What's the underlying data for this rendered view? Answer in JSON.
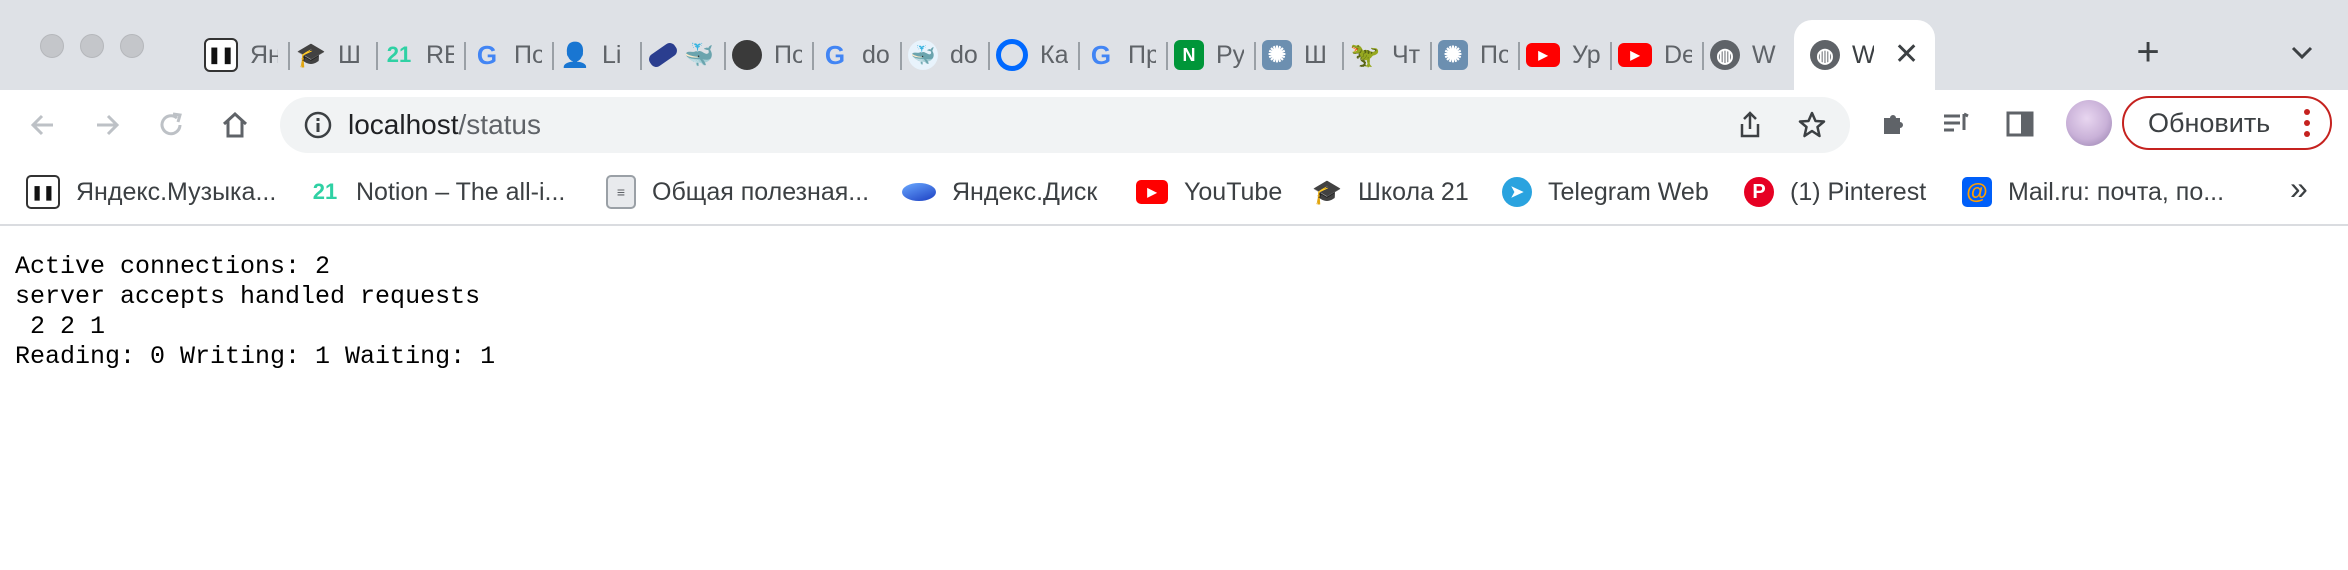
{
  "window": {
    "controls": [
      "close",
      "minimize",
      "zoom"
    ]
  },
  "tabs": [
    {
      "icon": "yandex-music-icon",
      "title": "Ян",
      "color": "#ffffff"
    },
    {
      "icon": "school21-icon",
      "title": "Ш",
      "color": "#ffffff"
    },
    {
      "icon": "notion-21-icon",
      "title": "RE",
      "color": "#ffffff"
    },
    {
      "icon": "google-icon",
      "title": "По",
      "color": "#ffffff"
    },
    {
      "icon": "linkedin-user-icon",
      "title": "Li",
      "color": "#ffffff"
    },
    {
      "icon": "usb-docker-icon",
      "title": "",
      "color": "#ffffff"
    },
    {
      "icon": "person-photo-icon",
      "title": "По",
      "color": "#ffffff"
    },
    {
      "icon": "google-icon",
      "title": "do",
      "color": "#ffffff"
    },
    {
      "icon": "docker-icon",
      "title": "do",
      "color": "#ffffff"
    },
    {
      "icon": "digitalocean-icon",
      "title": "Ка",
      "color": "#ffffff"
    },
    {
      "icon": "google-icon",
      "title": "Пр",
      "color": "#ffffff"
    },
    {
      "icon": "nginx-icon",
      "title": "Py",
      "color": "#ffffff"
    },
    {
      "icon": "splash-icon",
      "title": "Ш",
      "color": "#ffffff"
    },
    {
      "icon": "dino-icon",
      "title": "Чт",
      "color": "#ffffff"
    },
    {
      "icon": "splash-icon",
      "title": "По",
      "color": "#ffffff"
    },
    {
      "icon": "youtube-icon",
      "title": "Ур",
      "color": "#ffffff"
    },
    {
      "icon": "youtube-icon",
      "title": "De",
      "color": "#ffffff"
    },
    {
      "icon": "globe-icon",
      "title": "W",
      "color": "#ffffff"
    }
  ],
  "active_tab": {
    "icon": "globe-icon",
    "title": "W",
    "close": "✕"
  },
  "new_tab": "+",
  "toolbar": {
    "url_host": "localhost",
    "url_path": "/status",
    "update_label": "Обновить"
  },
  "bookmarks": [
    {
      "icon": "yandex-music-icon",
      "label": "Яндекс.Музыка..."
    },
    {
      "icon": "notion-21-icon",
      "label": "Notion – The all-i..."
    },
    {
      "icon": "document-icon",
      "label": "Общая полезная..."
    },
    {
      "icon": "yandex-disk-icon",
      "label": "Яндекс.Диск"
    },
    {
      "icon": "youtube-icon",
      "label": "YouTube"
    },
    {
      "icon": "school21-icon",
      "label": "Школа 21"
    },
    {
      "icon": "telegram-icon",
      "label": "Telegram Web"
    },
    {
      "icon": "pinterest-icon",
      "label": "(1) Pinterest"
    },
    {
      "icon": "mailru-icon",
      "label": "Mail.ru: почта, по..."
    }
  ],
  "bookmarks_more": "»",
  "page": {
    "text": "Active connections: 2 \nserver accepts handled requests\n 2 2 1 \nReading: 0 Writing: 1 Waiting: 1 "
  },
  "colors": {
    "tabstrip": "#dee1e6",
    "update_border": "#c5221f",
    "youtube": "#ff0000",
    "nginx": "#009639",
    "telegram": "#2aa3df",
    "pinterest": "#e60023",
    "mailru": "#005ff9"
  }
}
